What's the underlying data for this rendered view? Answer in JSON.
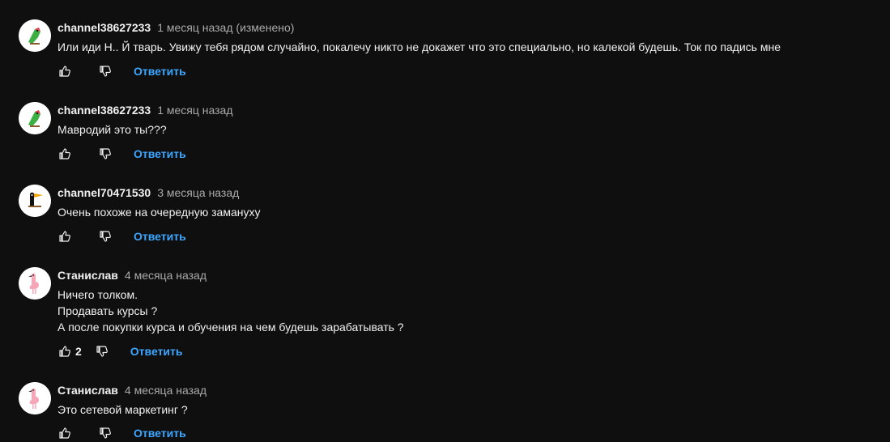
{
  "comments": [
    {
      "author": "channel38627233",
      "time": "1 месяц назад (изменено)",
      "lines": [
        "Или иди Н.. Й  тварь. Увижу тебя рядом случайно, покалечу никто не докажет что это специально, но калекой будешь. Ток по падись мне"
      ],
      "likes": "",
      "reply_label": "Ответить",
      "avatar": "parrot-avatar"
    },
    {
      "author": "channel38627233",
      "time": "1 месяц назад",
      "lines": [
        "Мавродий это ты???"
      ],
      "likes": "",
      "reply_label": "Ответить",
      "avatar": "parrot-avatar"
    },
    {
      "author": "channel70471530",
      "time": "3 месяца назад",
      "lines": [
        "Очень похоже на очередную замануху"
      ],
      "likes": "",
      "reply_label": "Ответить",
      "avatar": "toucan-avatar"
    },
    {
      "author": "Станислав",
      "time": "4 месяца назад",
      "lines": [
        "Ничего толком.",
        "Продавать курсы ?",
        "А после покупки курса и обучения на чем будешь зарабатывать ?"
      ],
      "likes": "2",
      "reply_label": "Ответить",
      "avatar": "flamingo-avatar"
    },
    {
      "author": "Станислав",
      "time": "4 месяца назад",
      "lines": [
        "Это сетевой маркетинг ?"
      ],
      "likes": "",
      "reply_label": "Ответить",
      "avatar": "flamingo-avatar"
    }
  ],
  "colors": {
    "background": "#0f0f0f",
    "text": "#f1f1f1",
    "secondary": "#aaaaaa",
    "link": "#3ea6ff"
  },
  "icons": {
    "like": "thumbs-up-icon",
    "dislike": "thumbs-down-icon"
  }
}
